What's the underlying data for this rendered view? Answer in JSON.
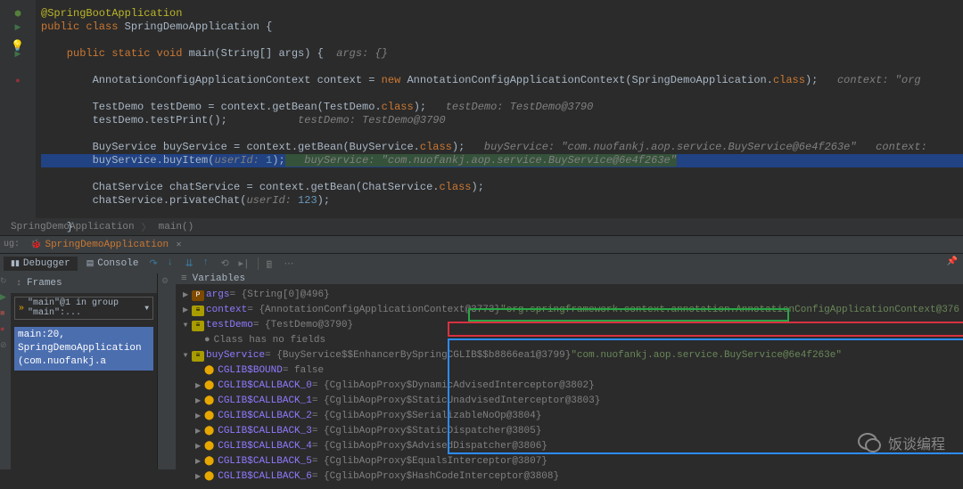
{
  "editor": {
    "line1": "@SpringBootApplication",
    "line2": {
      "pre": "public class ",
      "name": "SpringDemoApplication ",
      "brace": "{"
    },
    "line4": {
      "kw": "    public static void ",
      "sig": "main(String[] args) ",
      "brace": "{",
      "hint": "  args: {}"
    },
    "line6": {
      "a": "        AnnotationConfigApplicationContext context = ",
      "new": "new ",
      "b": "AnnotationConfigApplicationContext(SpringDemoApplication.",
      "cls": "class",
      "c": ");",
      "hint": "   context: \"org"
    },
    "line8": {
      "a": "        TestDemo testDemo = context.getBean(TestDemo.",
      "cls": "class",
      "b": ");",
      "hint": "   testDemo: TestDemo@3790"
    },
    "line9": {
      "a": "        testDemo.testPrint();",
      "hint": "           testDemo: TestDemo@3790"
    },
    "line11": {
      "a": "        BuyService buyService = context.getBean(BuyService.",
      "cls": "class",
      "b": ");",
      "hint": "   buyService: \"com.nuofankj.aop.service.BuyService@6e4f263e\"   context:"
    },
    "line12": {
      "a": "        buyService.buyItem(",
      "p": "userId: ",
      "n": "1",
      "b": ");",
      "hint": "   buyService: \"com.nuofankj.aop.service.BuyService@6e4f263e\""
    },
    "line14": {
      "a": "        ChatService chatService = context.getBean(ChatService.",
      "cls": "class",
      "b": ");"
    },
    "line15": {
      "a": "        chatService.privateChat(",
      "p": "userId: ",
      "n": "123",
      "b": ");"
    },
    "line17": "    }"
  },
  "breadcrumb": {
    "a": "SpringDemoApplication",
    "b": "main()"
  },
  "debugTab": "SpringDemoApplication",
  "subtabs": {
    "debugger": "Debugger",
    "console": "Console"
  },
  "frames": {
    "title": "Frames",
    "thread": "\"main\"@1 in group \"main\":...",
    "row": "main:20, SpringDemoApplication (com.nuofankj.a"
  },
  "vars": {
    "title": "Variables",
    "args": {
      "n": "args",
      "v": " = {String[0]@496}"
    },
    "context": {
      "n": "context",
      "v": " = {AnnotationConfigApplicationContext@3773} ",
      "s": "\"org.springframework.context.annotation.AnnotationConfigApplicationContext@376"
    },
    "testDemo": {
      "n": "testDemo",
      "v": " = {TestDemo@3790}"
    },
    "noFields": "Class has no fields",
    "buyService": {
      "n": "buyService",
      "v": " = {BuyService$$EnhancerBySpringCGLIB$$b8866ea1@3799} ",
      "s": "\"com.nuofankj.aop.service.BuyService@6e4f263e\""
    },
    "bound": {
      "n": "CGLIB$BOUND",
      "v": " = false"
    },
    "cb0": {
      "n": "CGLIB$CALLBACK_0",
      "v": " = {CglibAopProxy$DynamicAdvisedInterceptor@3802}"
    },
    "cb1": {
      "n": "CGLIB$CALLBACK_1",
      "v": " = {CglibAopProxy$StaticUnadvisedInterceptor@3803}"
    },
    "cb2": {
      "n": "CGLIB$CALLBACK_2",
      "v": " = {CglibAopProxy$SerializableNoOp@3804}"
    },
    "cb3": {
      "n": "CGLIB$CALLBACK_3",
      "v": " = {CglibAopProxy$StaticDispatcher@3805}"
    },
    "cb4": {
      "n": "CGLIB$CALLBACK_4",
      "v": " = {CglibAopProxy$AdvisedDispatcher@3806}"
    },
    "cb5": {
      "n": "CGLIB$CALLBACK_5",
      "v": " = {CglibAopProxy$EqualsInterceptor@3807}"
    },
    "cb6": {
      "n": "CGLIB$CALLBACK_6",
      "v": " = {CglibAopProxy$HashCodeInterceptor@3808}"
    }
  },
  "watermark": "饭谈编程",
  "prefix": "ug:"
}
